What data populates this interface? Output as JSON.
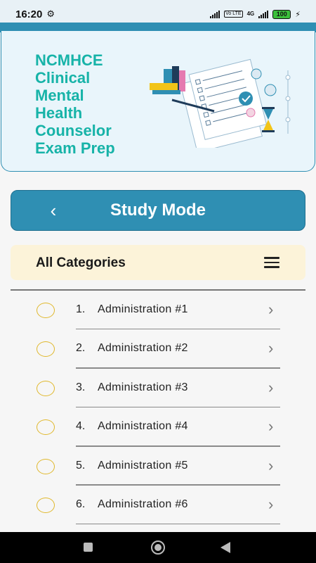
{
  "status": {
    "time": "16:20",
    "battery": "100",
    "volte": "Vo LTE",
    "network": "4G"
  },
  "banner": {
    "title_lines": [
      "NCMHCE",
      "Clinical",
      "Mental",
      "Health",
      "Counselor",
      "Exam Prep"
    ],
    "art_icon": "exam-illustration-icon"
  },
  "header": {
    "title": "Study Mode",
    "back_icon": "chevron-left-icon"
  },
  "categories": {
    "label": "All Categories",
    "menu_icon": "hamburger-menu-icon"
  },
  "items": [
    {
      "num": "1.",
      "label": "Administration #1"
    },
    {
      "num": "2.",
      "label": "Administration #2"
    },
    {
      "num": "3.",
      "label": "Administration #3"
    },
    {
      "num": "4.",
      "label": "Administration #4"
    },
    {
      "num": "5.",
      "label": "Administration #5"
    },
    {
      "num": "6.",
      "label": "Administration #6"
    }
  ],
  "colors": {
    "accent": "#2f8fb3",
    "title": "#17b3a8",
    "category_bg": "#fcf3d9",
    "radio": "#e0b82c"
  }
}
